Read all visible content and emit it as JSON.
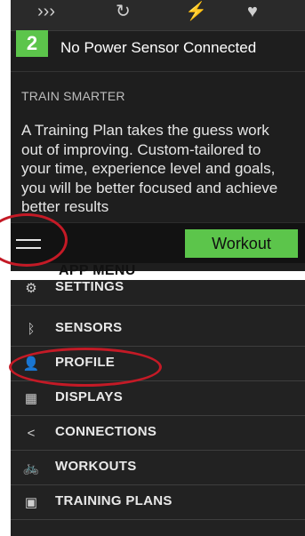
{
  "top": {
    "badge_number": "2",
    "power_sensor_text": "No Power Sensor Connected",
    "section_title": "TRAIN SMARTER",
    "section_body": "A Training Plan takes the guess work out of improving. Custom-tailored to your time, experience level and goals, you will be better focused and achieve better results",
    "workout_button": "Workout",
    "icons": [
      "chevrons-right-icon",
      "refresh-icon",
      "lightning-icon",
      "heart-icon"
    ]
  },
  "caption": "APP MENU",
  "menu": {
    "items": [
      {
        "label": "SETTINGS",
        "icon": "gear-icon"
      },
      {
        "label": "SENSORS",
        "icon": "bluetooth-icon"
      },
      {
        "label": "PROFILE",
        "icon": "person-icon"
      },
      {
        "label": "DISPLAYS",
        "icon": "grid-icon"
      },
      {
        "label": "CONNECTIONS",
        "icon": "share-icon"
      },
      {
        "label": "WORKOUTS",
        "icon": "bicycle-icon"
      },
      {
        "label": "TRAINING PLANS",
        "icon": "calendar-icon"
      }
    ]
  },
  "colors": {
    "accent_green": "#5cc54b",
    "highlight_red": "#c41a26",
    "panel_dark": "#1e1e1e"
  }
}
